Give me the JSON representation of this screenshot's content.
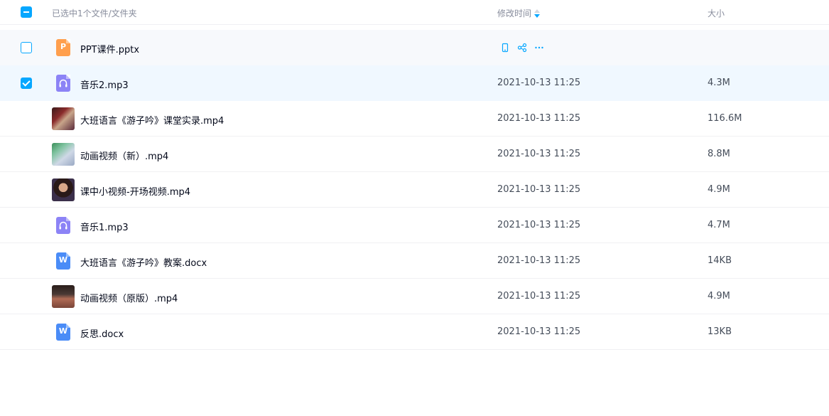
{
  "header": {
    "selected_text": "已选中1个文件/文件夹",
    "col_time": "修改时间",
    "col_size": "大小"
  },
  "rows": [
    {
      "name": "PPT课件.pptx",
      "time": "",
      "size": "",
      "icon": "ppt-file-icon",
      "state": "hover"
    },
    {
      "name": "音乐2.mp3",
      "time": "2021-10-13 11:25",
      "size": "4.3M",
      "icon": "audio-file-icon",
      "state": "selected"
    },
    {
      "name": "大班语言《游子吟》课堂实录.mp4",
      "time": "2021-10-13 11:25",
      "size": "116.6M",
      "icon": "video-thumbnail"
    },
    {
      "name": "动画视频（新）.mp4",
      "time": "2021-10-13 11:25",
      "size": "8.8M",
      "icon": "video-thumbnail"
    },
    {
      "name": "课中小视频-开场视频.mp4",
      "time": "2021-10-13 11:25",
      "size": "4.9M",
      "icon": "video-thumbnail"
    },
    {
      "name": "音乐1.mp3",
      "time": "2021-10-13 11:25",
      "size": "4.7M",
      "icon": "audio-file-icon"
    },
    {
      "name": "大班语言《游子吟》教案.docx",
      "time": "2021-10-13 11:25",
      "size": "14KB",
      "icon": "word-file-icon"
    },
    {
      "name": "动画视频（原版）.mp4",
      "time": "2021-10-13 11:25",
      "size": "4.9M",
      "icon": "video-thumbnail"
    },
    {
      "name": "反思.docx",
      "time": "2021-10-13 11:25",
      "size": "13KB",
      "icon": "word-file-icon"
    }
  ],
  "colors": {
    "accent": "#06a7ff",
    "hover_row": "#f7f9fc",
    "selected_row": "#f0f8ff",
    "ppt": "#ff9f4d",
    "audio": "#8c83f6",
    "word": "#4a8cf7"
  },
  "row_actions": [
    "phone-icon",
    "share-icon",
    "more-icon"
  ]
}
